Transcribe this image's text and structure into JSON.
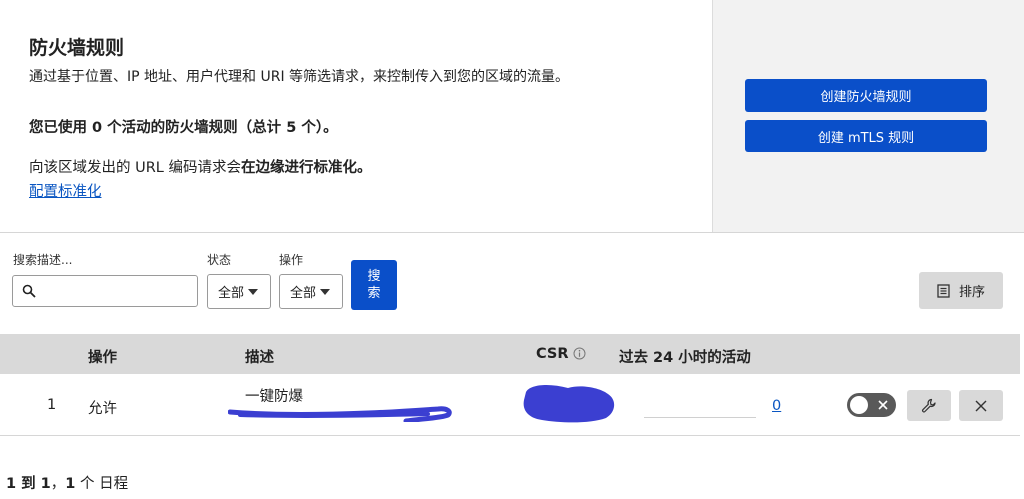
{
  "header": {
    "title": "防火墙规则",
    "description": "通过基于位置、IP 地址、用户代理和 URI 等筛选请求，来控制传入到您的区域的流量。",
    "usage_text": "您已使用 0 个活动的防火墙规则（总计 5 个）。",
    "normalization_prefix": "向该区域发出的 URL 编码请求会",
    "normalization_bold": "在边缘进行标准化。",
    "normalization_link": "配置标准化",
    "create_rule_button": "创建防火墙规则",
    "create_mtls_button": "创建 mTLS 规则"
  },
  "filters": {
    "search_label": "搜索描述...",
    "search_value": "",
    "status_label": "状态",
    "status_value": "全部",
    "action_label": "操作",
    "action_value": "全部",
    "search_button": "搜索",
    "sort_button": "排序"
  },
  "table": {
    "headers": {
      "action": "操作",
      "description": "描述",
      "csr": "CSR",
      "activity": "过去 24 小时的活动"
    },
    "rows": [
      {
        "priority": "1",
        "action": "允许",
        "description": "一键防爆",
        "activity_count": "0",
        "enabled": false
      }
    ]
  },
  "pagination": {
    "range": "1 到 1",
    "separator": "，",
    "total": "1",
    "suffix": " 个 日程"
  },
  "colors": {
    "primary": "#0a4fc9",
    "link": "#0a56c2",
    "redaction": "#3b3fd1"
  },
  "icons": {
    "search": "search-icon",
    "sort": "document-list-icon",
    "edit": "wrench-icon",
    "delete": "close-icon",
    "toggle_off": "close-icon",
    "info": "info-icon"
  }
}
